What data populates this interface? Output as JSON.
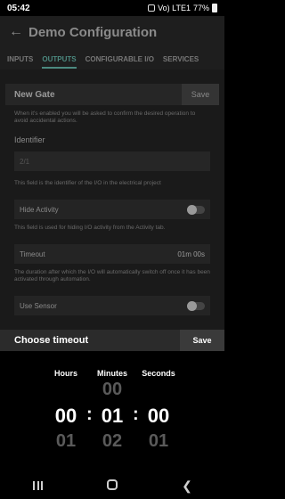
{
  "status_bar": {
    "time": "05:42",
    "network": "Vo) LTE1",
    "battery": "77%"
  },
  "app_bar": {
    "title": "Demo Configuration",
    "back_icon": "arrow-left-icon"
  },
  "tabs": [
    {
      "label": "INPUTS",
      "active": false
    },
    {
      "label": "OUTPUTS",
      "active": true
    },
    {
      "label": "CONFIGURABLE I/O",
      "active": false
    },
    {
      "label": "SERVICES",
      "active": false
    }
  ],
  "gate": {
    "title": "New Gate",
    "save_label": "Save",
    "confirm_help": "When it's enabled you will be asked to confirm the desired operation to avoid accidental actions.",
    "identifier_label": "Identifier",
    "identifier_value": "2/1",
    "identifier_help": "This field is the identifier of the I/O in the electrical project",
    "hide_activity_label": "Hide Activity",
    "hide_activity_enabled": false,
    "hide_activity_help": "This field is used for hiding I/O activity from the Activity tab.",
    "timeout_label": "Timeout",
    "timeout_value": "01m 00s",
    "timeout_help": "The duration after which the I/O will automatically switch off once it has been activated through automation.",
    "use_sensor_label": "Use Sensor",
    "use_sensor_enabled": false
  },
  "timeout_sheet": {
    "title": "Choose timeout",
    "save_label": "Save",
    "columns": [
      {
        "label": "Hours",
        "above": "",
        "selected": "00",
        "below": "01"
      },
      {
        "label": "Minutes",
        "above": "00",
        "selected": "01",
        "below": "02"
      },
      {
        "label": "Seconds",
        "above": "",
        "selected": "00",
        "below": "01"
      }
    ],
    "separator": ":"
  },
  "nav_bar": {
    "recent_icon": "recent-apps-icon",
    "home_icon": "home-icon",
    "back_icon": "back-chevron-icon"
  },
  "colors": {
    "accent": "#4c8a80",
    "sheet_background": "#000000",
    "dim_overlay": "#1a1a1a"
  }
}
